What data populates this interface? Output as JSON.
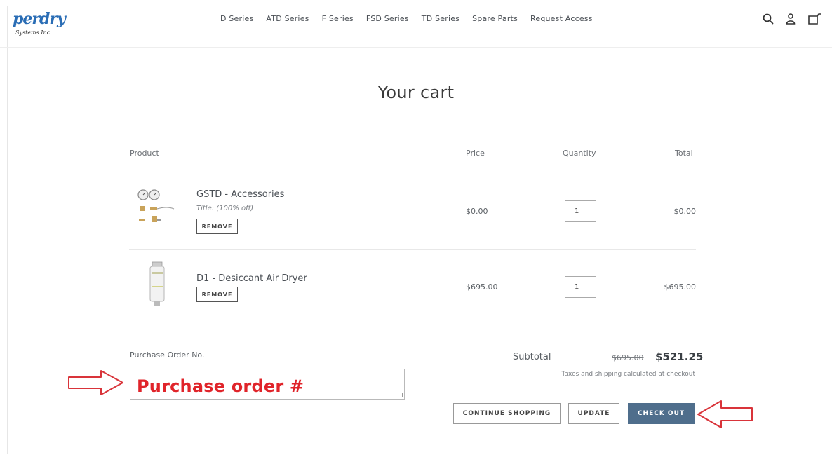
{
  "header": {
    "logo_text": "perdry",
    "logo_subtext": "Systems Inc.",
    "nav": [
      "D Series",
      "ATD Series",
      "F Series",
      "FSD Series",
      "TD Series",
      "Spare Parts",
      "Request Access"
    ],
    "icons": [
      "search-icon",
      "account-icon",
      "cart-icon"
    ]
  },
  "page": {
    "title": "Your cart"
  },
  "table": {
    "columns": {
      "product": "Product",
      "price": "Price",
      "quantity": "Quantity",
      "total": "Total"
    },
    "rows": [
      {
        "name": "GSTD - Accessories",
        "variant": "Title: (100% off)",
        "remove_label": "REMOVE",
        "price": "$0.00",
        "quantity": "1",
        "total": "$0.00"
      },
      {
        "name": "D1 - Desiccant Air Dryer",
        "variant": "",
        "remove_label": "REMOVE",
        "price": "$695.00",
        "quantity": "1",
        "total": "$695.00"
      }
    ]
  },
  "purchase_order": {
    "label": "Purchase Order No.",
    "value": "Purchase order #"
  },
  "summary": {
    "subtotal_label": "Subtotal",
    "original_price": "$695.00",
    "discounted_price": "$521.25",
    "tax_note": "Taxes and shipping calculated at checkout"
  },
  "actions": {
    "continue_label": "CONTINUE SHOPPING",
    "update_label": "UPDATE",
    "checkout_label": "CHECK OUT"
  },
  "colors": {
    "accent": "#4f6e8c",
    "annotation_red": "#e0242a",
    "logo_blue": "#2a6db5"
  }
}
